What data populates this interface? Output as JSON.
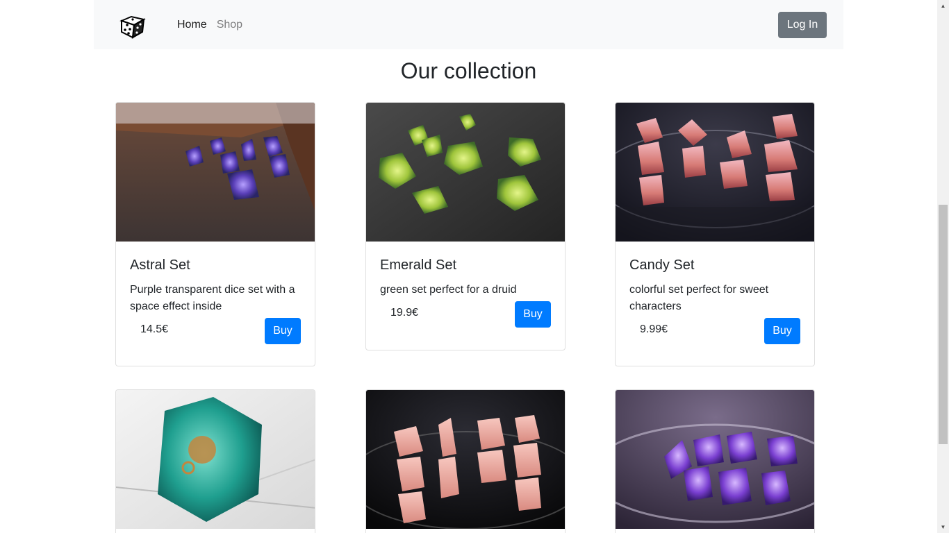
{
  "nav": {
    "brand_icon": "dice-logo-icon",
    "links": [
      {
        "label": "Home"
      },
      {
        "label": "Shop"
      }
    ],
    "login_label": "Log In"
  },
  "page_title": "Our collection",
  "products": [
    {
      "title": "Astral Set",
      "description": "Purple transparent dice set with a space effect inside",
      "price": "14.5€",
      "button": "Buy"
    },
    {
      "title": "Emerald Set",
      "description": "green set perfect for a druid",
      "price": "19.9€",
      "button": "Buy"
    },
    {
      "title": "Candy Set",
      "description": "colorful set perfect for sweet characters",
      "price": "9.99€",
      "button": "Buy"
    }
  ],
  "colors": {
    "primary": "#007bff",
    "secondary": "#6c757d",
    "navbar_bg": "#f8f9fa"
  }
}
